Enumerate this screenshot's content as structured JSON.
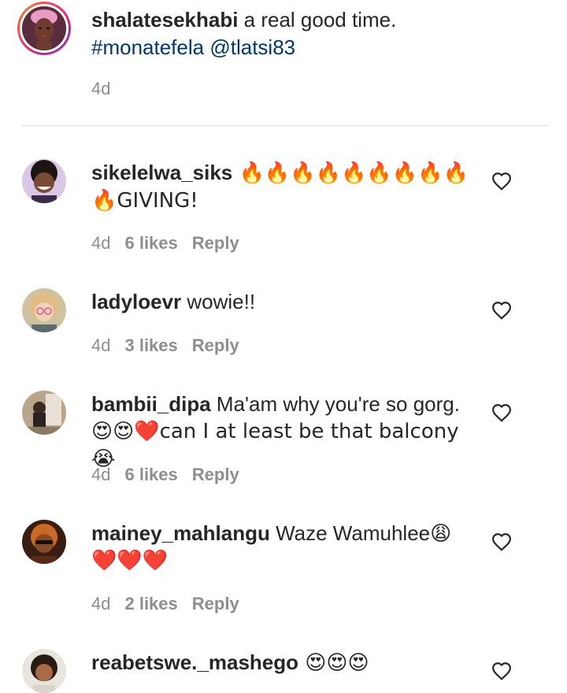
{
  "caption": {
    "username": "shalatesekhabi",
    "text": " a real good time.",
    "hashtag": "#monatefela",
    "mention": "@tlatsi83",
    "time": "4d"
  },
  "comments": [
    {
      "username": "sikelelwa_siks",
      "text": " 🔥🔥🔥🔥🔥🔥🔥🔥🔥",
      "text2": "🔥GIVING!",
      "time": "4d",
      "likes": "6 likes",
      "reply": "Reply"
    },
    {
      "username": "ladyloevr",
      "text": " wowie!!",
      "text2": "",
      "time": "4d",
      "likes": "3 likes",
      "reply": "Reply"
    },
    {
      "username": "bambii_dipa",
      "text": " Ma'am why you're so gorg.",
      "text2": "😍😍❤️can I at least be that balcony😭",
      "time": "4d",
      "likes": "6 likes",
      "reply": "Reply"
    },
    {
      "username": "mainey_mahlangu",
      "text": " Waze Wamuhlee😩",
      "text2": "❤️❤️❤️",
      "time": "4d",
      "likes": "2 likes",
      "reply": "Reply"
    },
    {
      "username": "reabetswe._mashego",
      "text": " 😍😍😍",
      "text2": "",
      "time": "",
      "likes": "",
      "reply": ""
    }
  ],
  "icons": {
    "like": "heart-outline-icon"
  },
  "colors": {
    "username": "#262626",
    "link": "#00376b",
    "meta": "#8e8e8e",
    "divider": "#dbdbdb"
  }
}
